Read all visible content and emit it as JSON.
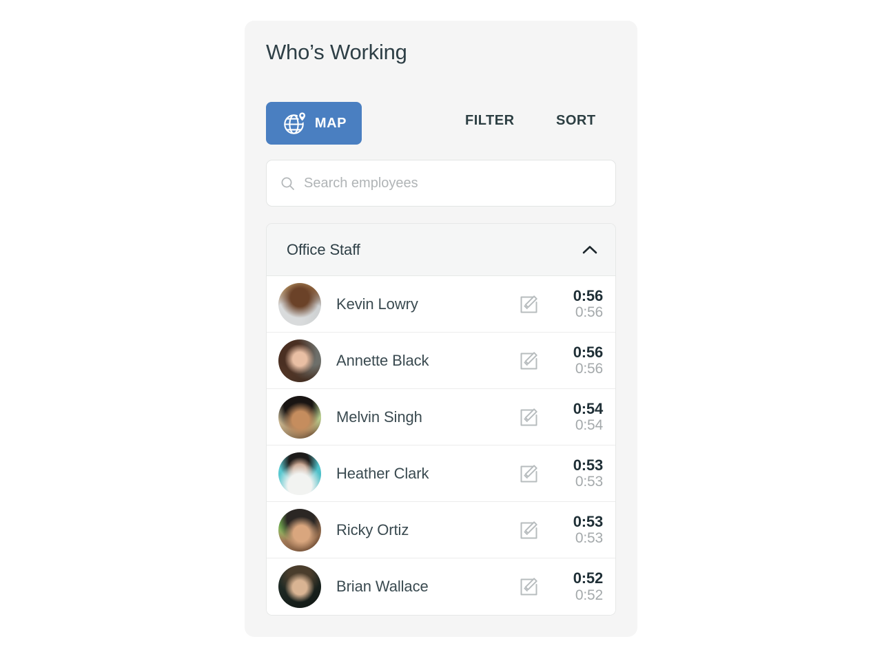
{
  "panel": {
    "title": "Who’s Working"
  },
  "toolbar": {
    "map_label": "MAP",
    "filter_label": "FILTER",
    "sort_label": "SORT",
    "map_icon": "globe-pin-icon",
    "map_button_color": "#4a7fc1"
  },
  "search": {
    "placeholder": "Search employees",
    "value": "",
    "icon": "search-icon"
  },
  "group": {
    "name": "Office Staff",
    "collapse_icon": "chevron-up-icon",
    "expanded": true
  },
  "colors": {
    "page_background": "#ffffff",
    "panel_background": "#f5f5f5",
    "card_background": "#ffffff",
    "accent_blue": "#4a7fc1",
    "text_primary": "#2e3f46",
    "text_name": "#3a4a50",
    "time_main": "#1f2f36",
    "time_sub": "#a4a9ab",
    "placeholder": "#b0b4b6",
    "divider": "#ececec"
  },
  "employees": [
    {
      "name": "Kevin Lowry",
      "time_total": "0:56",
      "time_sub": "0:56",
      "edit_icon": "edit-pencil-icon",
      "avatar": "avatar-kevin-lowry"
    },
    {
      "name": "Annette Black",
      "time_total": "0:56",
      "time_sub": "0:56",
      "edit_icon": "edit-pencil-icon",
      "avatar": "avatar-annette-black"
    },
    {
      "name": "Melvin Singh",
      "time_total": "0:54",
      "time_sub": "0:54",
      "edit_icon": "edit-pencil-icon",
      "avatar": "avatar-melvin-singh"
    },
    {
      "name": "Heather Clark",
      "time_total": "0:53",
      "time_sub": "0:53",
      "edit_icon": "edit-pencil-icon",
      "avatar": "avatar-heather-clark"
    },
    {
      "name": "Ricky Ortiz",
      "time_total": "0:53",
      "time_sub": "0:53",
      "edit_icon": "edit-pencil-icon",
      "avatar": "avatar-ricky-ortiz"
    },
    {
      "name": "Brian Wallace",
      "time_total": "0:52",
      "time_sub": "0:52",
      "edit_icon": "edit-pencil-icon",
      "avatar": "avatar-brian-wallace"
    }
  ]
}
